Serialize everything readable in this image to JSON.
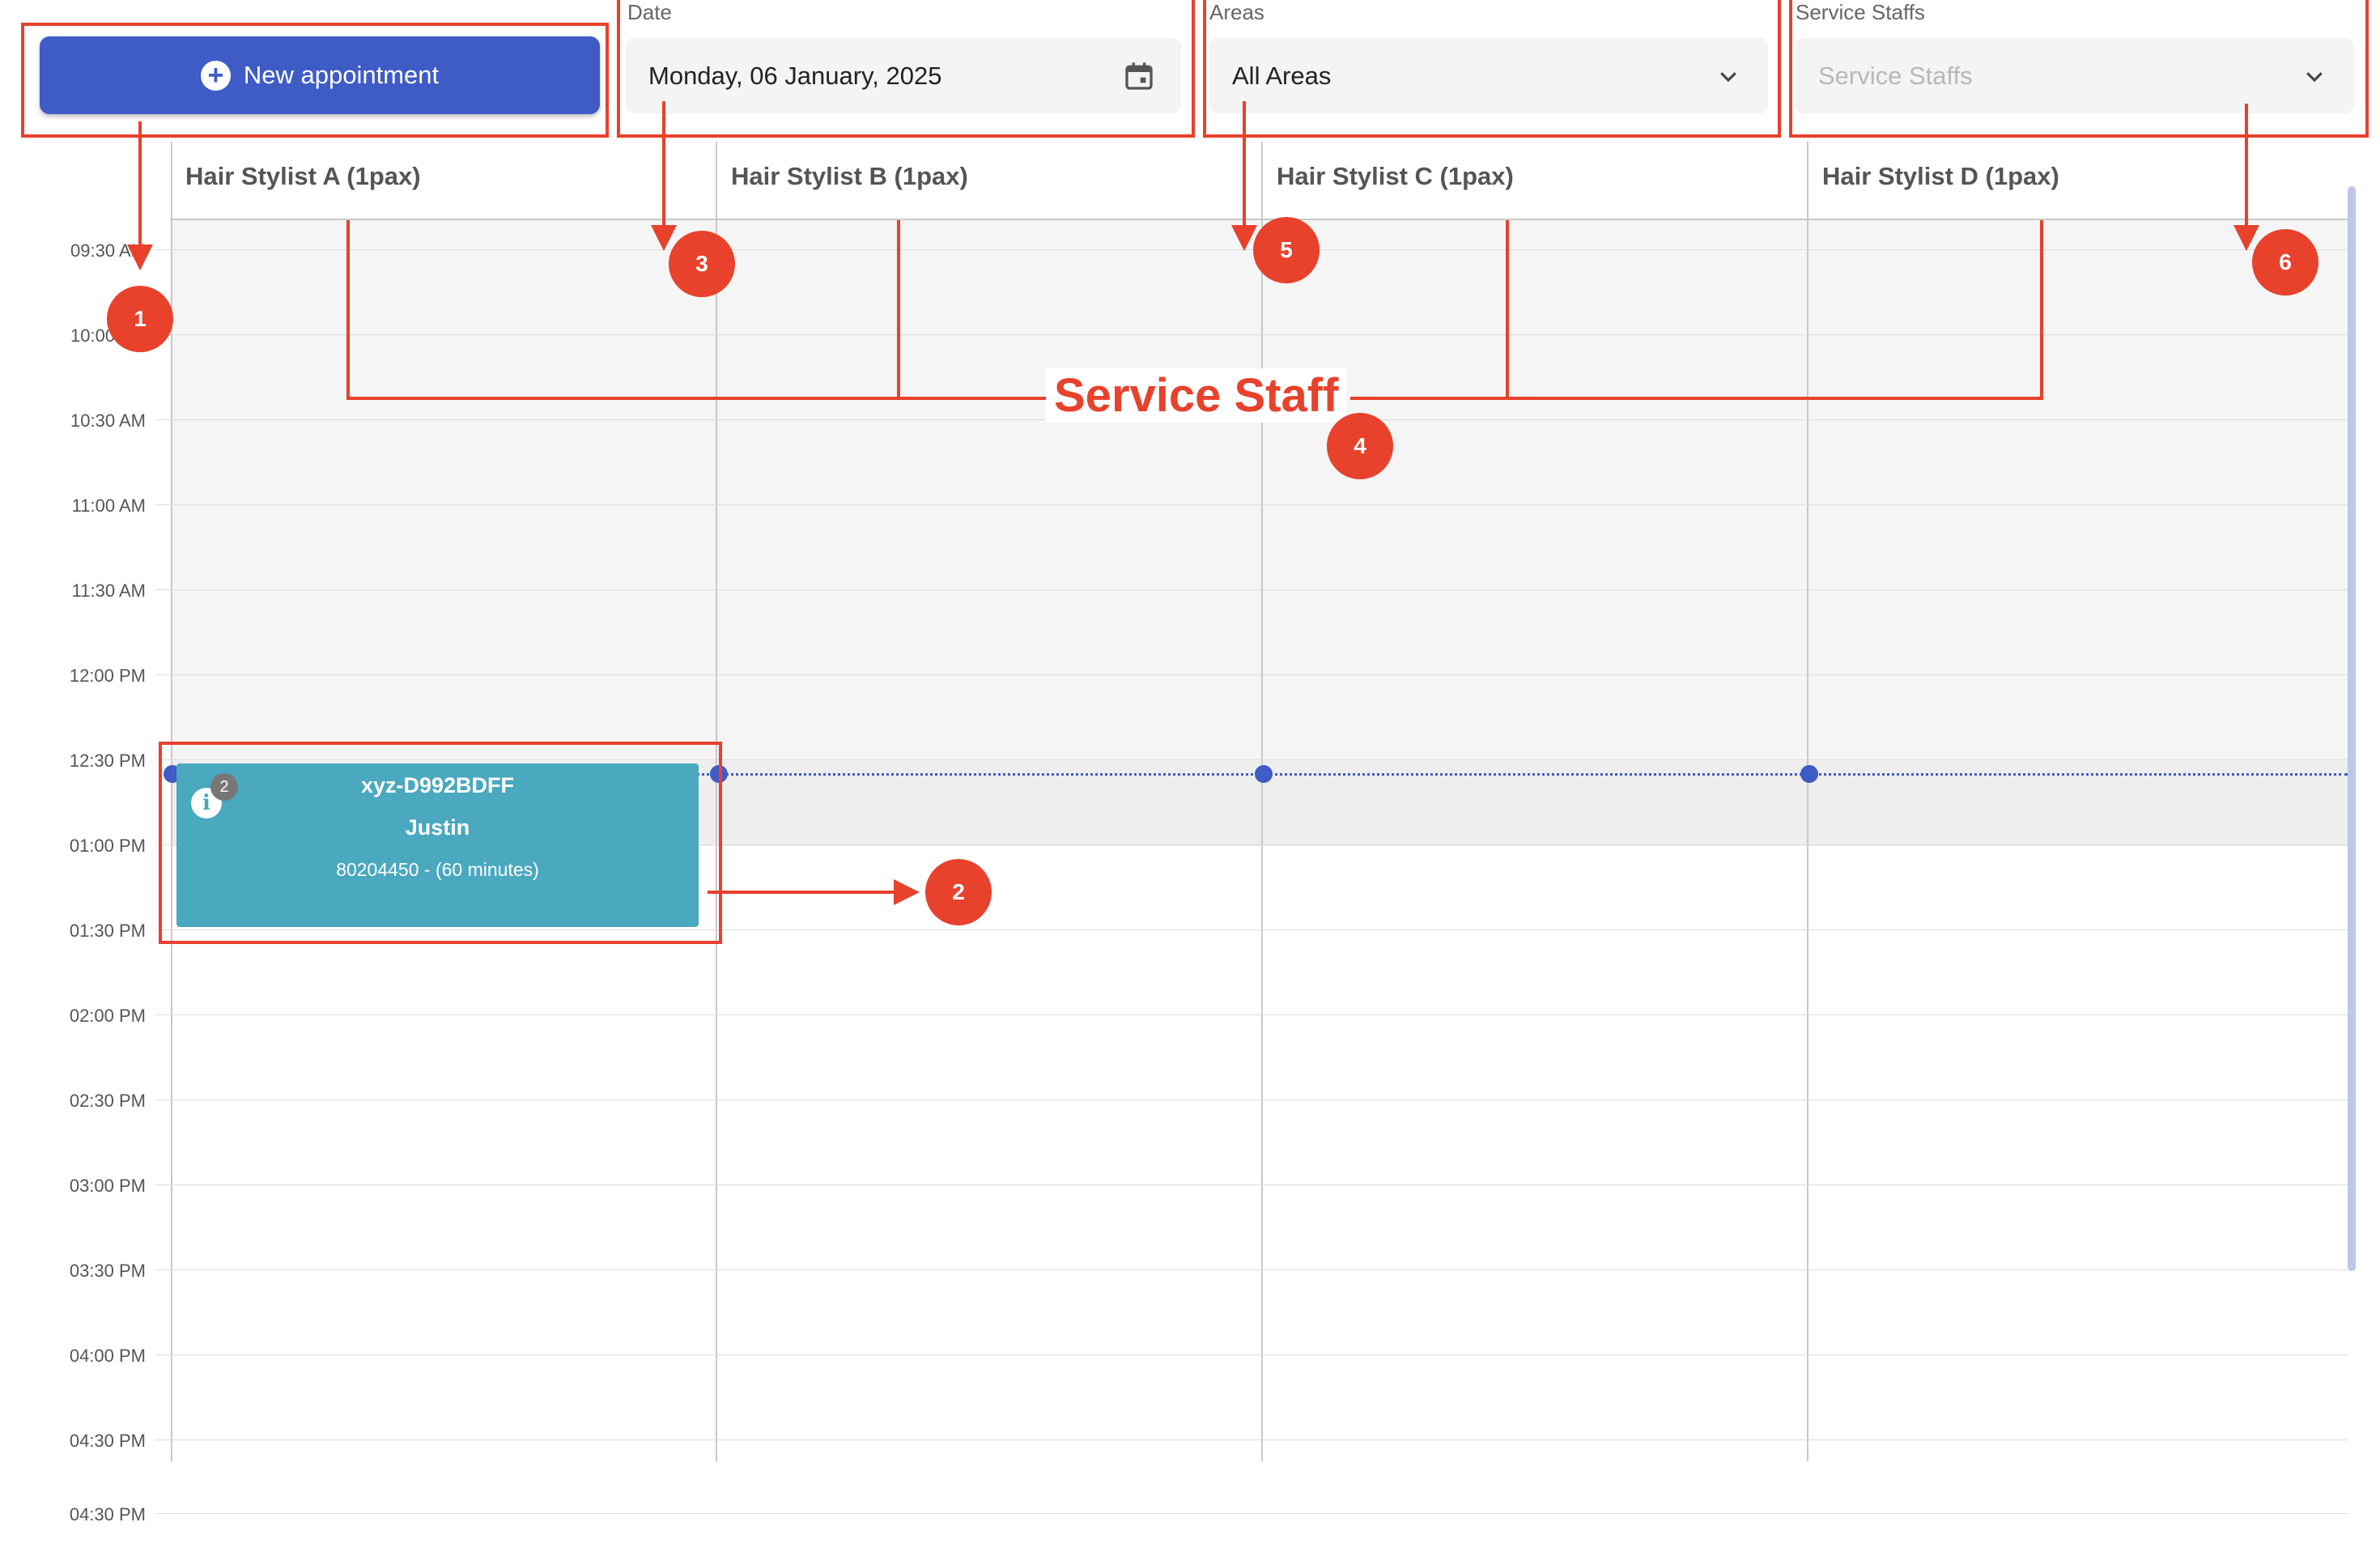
{
  "toolbar": {
    "new_appointment_label": "New appointment",
    "date_label": "Date",
    "date_value": "Monday, 06 January, 2025",
    "areas_label": "Areas",
    "areas_value": "All Areas",
    "staff_label": "Service Staffs",
    "staff_placeholder": "Service Staffs"
  },
  "columns": [
    {
      "header": "Hair Stylist A (1pax)"
    },
    {
      "header": "Hair Stylist B (1pax)"
    },
    {
      "header": "Hair Stylist C (1pax)"
    },
    {
      "header": "Hair Stylist D (1pax)"
    }
  ],
  "times": [
    "09:30 AM",
    "10:00 AM",
    "10:30 AM",
    "11:00 AM",
    "11:30 AM",
    "12:00 PM",
    "12:30 PM",
    "01:00 PM",
    "01:30 PM",
    "02:00 PM",
    "02:30 PM",
    "03:00 PM",
    "03:30 PM",
    "04:00 PM",
    "04:30 PM"
  ],
  "footer_time": "04:30 PM",
  "appointment": {
    "code": "xyz-D992BDFF",
    "name": "Justin",
    "detail": "80204450 - (60 minutes)",
    "count": "2"
  },
  "annotations": {
    "title": "Service Staff",
    "n1": "1",
    "n2": "2",
    "n3": "3",
    "n4": "4",
    "n5": "5",
    "n6": "6"
  },
  "colors": {
    "accent": "#3f5bc6",
    "appointment": "#4aa8bf",
    "annotation": "#e8412c"
  }
}
